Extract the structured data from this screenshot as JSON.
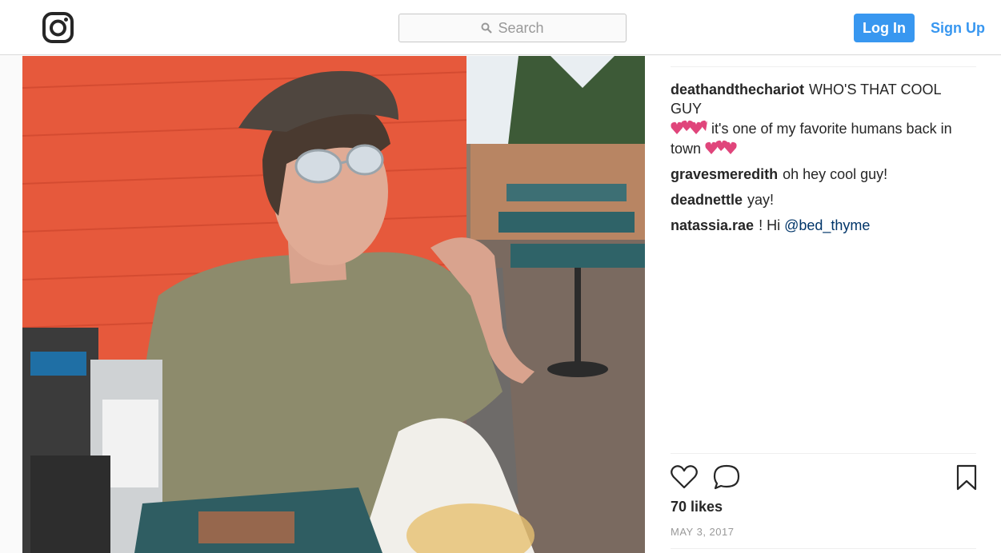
{
  "header": {
    "logo_icon": "instagram-logo-icon",
    "search_placeholder": "Search",
    "login_label": "Log In",
    "signup_label": "Sign Up"
  },
  "photo": {
    "icon": "post-photo"
  },
  "comments": [
    {
      "user": "deathandthechariot",
      "text_a": "WHO'S THAT COOL GUY",
      "text_b": "it's one of my favorite humans back in town",
      "emoji": "two-hearts-icon"
    },
    {
      "user": "gravesmeredith",
      "text": "oh hey cool guy!"
    },
    {
      "user": "deadnettle",
      "text": "yay!"
    },
    {
      "user": "natassia.rae",
      "text": "! Hi",
      "mention": "@bed_thyme"
    }
  ],
  "actions": {
    "like_icon": "heart-icon",
    "comment_icon": "comment-icon",
    "save_icon": "bookmark-icon"
  },
  "likes": "70 likes",
  "date": "MAY 3, 2017",
  "colors": {
    "accent": "#3897f0",
    "mention": "#003569",
    "emoji": "#e0457b"
  }
}
